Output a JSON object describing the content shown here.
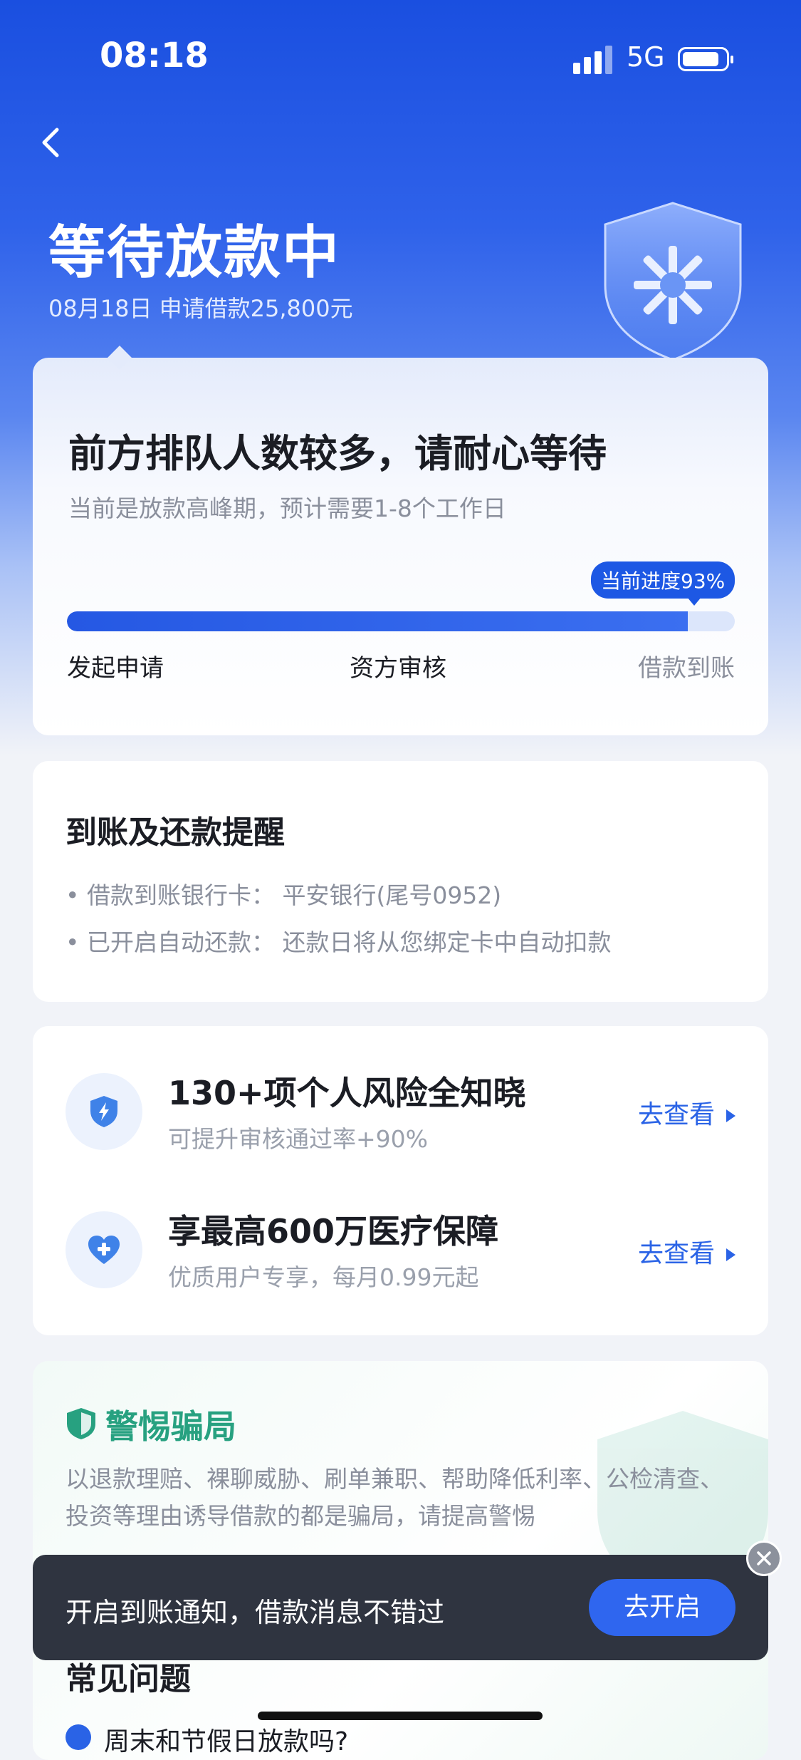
{
  "status_bar": {
    "time": "08:18",
    "network": "5G"
  },
  "header": {
    "title": "等待放款中",
    "subtitle": "08月18日 申请借款25,800元"
  },
  "progress_card": {
    "title": "前方排队人数较多，请耐心等待",
    "subtitle": "当前是放款高峰期，预计需要1-8个工作日",
    "badge": "当前进度93%",
    "progress_percent": 93,
    "steps": [
      "发起申请",
      "资方审核",
      "借款到账"
    ]
  },
  "reminder_card": {
    "title": "到账及还款提醒",
    "lines": [
      "• 借款到账银行卡：  平安银行(尾号0952)",
      "• 已开启自动还款：  还款日将从您绑定卡中自动扣款"
    ]
  },
  "services": [
    {
      "icon": "lightning-shield-icon",
      "title": "130+项个人风险全知晓",
      "subtitle": "可提升审核通过率+90%",
      "link": "去查看"
    },
    {
      "icon": "heart-plus-icon",
      "title": "享最高600万医疗保障",
      "subtitle": "优质用户专享，每月0.99元起",
      "link": "去查看"
    }
  ],
  "fraud_warning": {
    "title": "警惕骗局",
    "text": "以退款理赔、裸聊威胁、刷单兼职、帮助降低利率、公检清查、投资等理由诱导借款的都是骗局，请提高警惕"
  },
  "faq": {
    "title": "常见问题",
    "first_question": "周末和节假日放款吗?"
  },
  "toast": {
    "text": "开启到账通知，借款消息不错过",
    "button": "去开启"
  },
  "colors": {
    "primary": "#2558e3",
    "warning_green": "#27a180",
    "toast_bg": "#2f3440"
  }
}
